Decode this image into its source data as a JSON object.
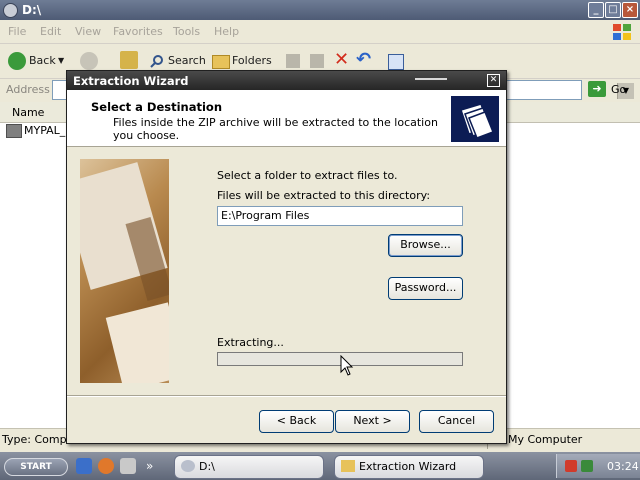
{
  "explorer": {
    "title": "D:\\",
    "menu": [
      "File",
      "Edit",
      "View",
      "Favorites",
      "Tools",
      "Help"
    ],
    "toolbar": {
      "back": "Back",
      "search": "Search",
      "folders": "Folders"
    },
    "address_label": "Address",
    "go": "Go",
    "column_header": "Name",
    "files": [
      {
        "name": "MYPAL_6"
      }
    ],
    "status_left": "Type: Compre",
    "status_right": "My Computer"
  },
  "dialog": {
    "title": "Extraction Wizard",
    "header_title": "Select a Destination",
    "header_subtitle": "Files inside the ZIP archive will be extracted to the location you choose.",
    "instruction": "Select a folder to extract files to.",
    "directory_label": "Files will be extracted to this directory:",
    "directory_value": "E:\\Program Files",
    "browse": "Browse...",
    "password": "Password...",
    "progress_label": "Extracting...",
    "progress": 0,
    "back": "< Back",
    "next": "Next >",
    "cancel": "Cancel"
  },
  "taskbar": {
    "start": "START",
    "more": "»",
    "tasks": [
      "D:\\",
      "Extraction Wizard"
    ],
    "clock": "03:24"
  },
  "icons": [
    "explorer-window-icon",
    "windows-logo-icon",
    "back-arrow-icon",
    "forward-arrow-icon",
    "up-folder-icon",
    "search-icon",
    "folders-icon",
    "move-to-icon",
    "copy-to-icon",
    "delete-icon",
    "undo-icon",
    "views-icon",
    "go-arrow-icon",
    "zip-file-icon",
    "folder-stack-icon",
    "mouse-cursor-icon"
  ],
  "colors": {
    "dialog_title": "#262626",
    "progress_fill": "#3a8bde",
    "header_icon_bg": "#0c1c54"
  }
}
